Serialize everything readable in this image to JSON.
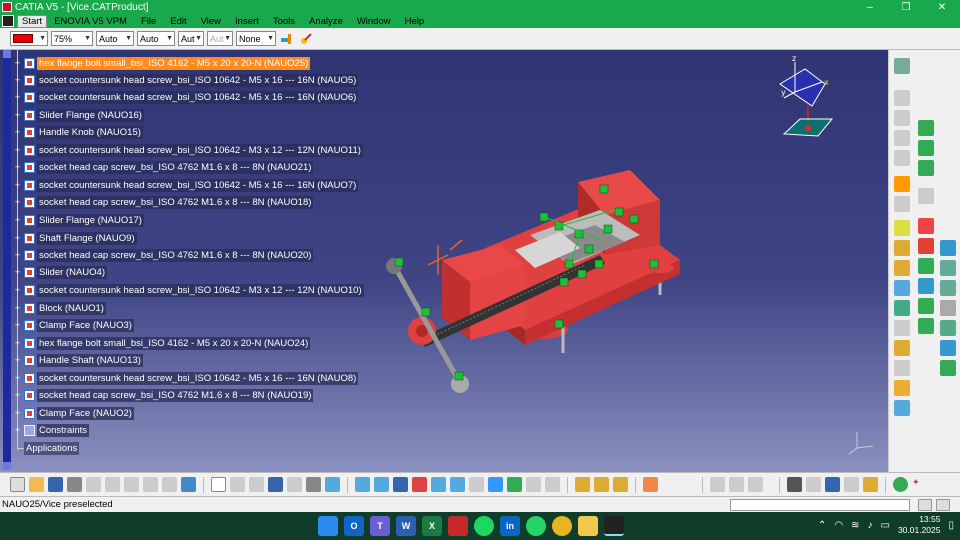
{
  "window": {
    "title": "CATIA V5 - [Vice.CATProduct]",
    "controls": [
      "–",
      "❐",
      "✕"
    ]
  },
  "menubar": {
    "items": [
      "Start",
      "ENOVIA V5 VPM",
      "File",
      "Edit",
      "View",
      "Insert",
      "Tools",
      "Analyze",
      "Window",
      "Help"
    ]
  },
  "graphic_properties": {
    "color": "#ee0000",
    "transparency": "75%",
    "line_thickness": "Auto",
    "line_type": "Auto",
    "point_type": "Aut",
    "render_style": "Aut",
    "layer": "None"
  },
  "tree": {
    "nodes": [
      {
        "label": "hex flange bolt small_bsi_ISO 4162 - M5 x 20 x 20-N (NAUO25)",
        "selected": true
      },
      {
        "label": "socket countersunk head screw_bsi_ISO 10642 - M5 x 16 --- 16N (NAUO5)"
      },
      {
        "label": "socket countersunk head screw_bsi_ISO 10642 - M5 x 16 --- 16N (NAUO6)"
      },
      {
        "label": "Slider Flange (NAUO16)"
      },
      {
        "label": "Handle Knob (NAUO15)"
      },
      {
        "label": "socket countersunk head screw_bsi_ISO 10642 - M3 x 12 --- 12N (NAUO11)"
      },
      {
        "label": "socket head cap screw_bsi_ISO 4762 M1.6 x 8 --- 8N (NAUO21)"
      },
      {
        "label": "socket countersunk head screw_bsi_ISO 10642 - M5 x 16 --- 16N (NAUO7)"
      },
      {
        "label": "socket head cap screw_bsi_ISO 4762 M1.6 x 8 --- 8N (NAUO18)"
      },
      {
        "label": "Slider Flange (NAUO17)"
      },
      {
        "label": "Shaft Flange (NAUO9)"
      },
      {
        "label": "socket head cap screw_bsi_ISO 4762 M1.6 x 8 --- 8N (NAUO20)"
      },
      {
        "label": "Slider (NAUO4)"
      },
      {
        "label": "socket countersunk head screw_bsi_ISO 10642 - M3 x 12 --- 12N (NAUO10)"
      },
      {
        "label": "Block (NAUO1)"
      },
      {
        "label": "Clamp Face (NAUO3)"
      },
      {
        "label": "hex flange bolt small_bsi_ISO 4162 - M5 x 20 x 20-N (NAUO24)"
      },
      {
        "label": "Handle Shaft (NAUO13)"
      },
      {
        "label": "socket countersunk head screw_bsi_ISO 10642 - M5 x 16 --- 16N (NAUO8)"
      },
      {
        "label": "socket head cap screw_bsi_ISO 4762 M1.6 x 8 --- 8N (NAUO19)"
      },
      {
        "label": "Clamp Face (NAUO2)"
      },
      {
        "label": "Constraints"
      },
      {
        "label": "Applications"
      }
    ]
  },
  "compass": {
    "x": "x",
    "y": "y",
    "z": "z"
  },
  "status": {
    "text": "NAUO25/Vice preselected"
  },
  "taskbar": {
    "time": "13:55",
    "date": "30.01.2025"
  },
  "colors": {
    "titlebar": "#19a84b",
    "selection": "#ff8a1e",
    "model_red": "#e23b3b",
    "constraint_green": "#1fbf3a"
  }
}
